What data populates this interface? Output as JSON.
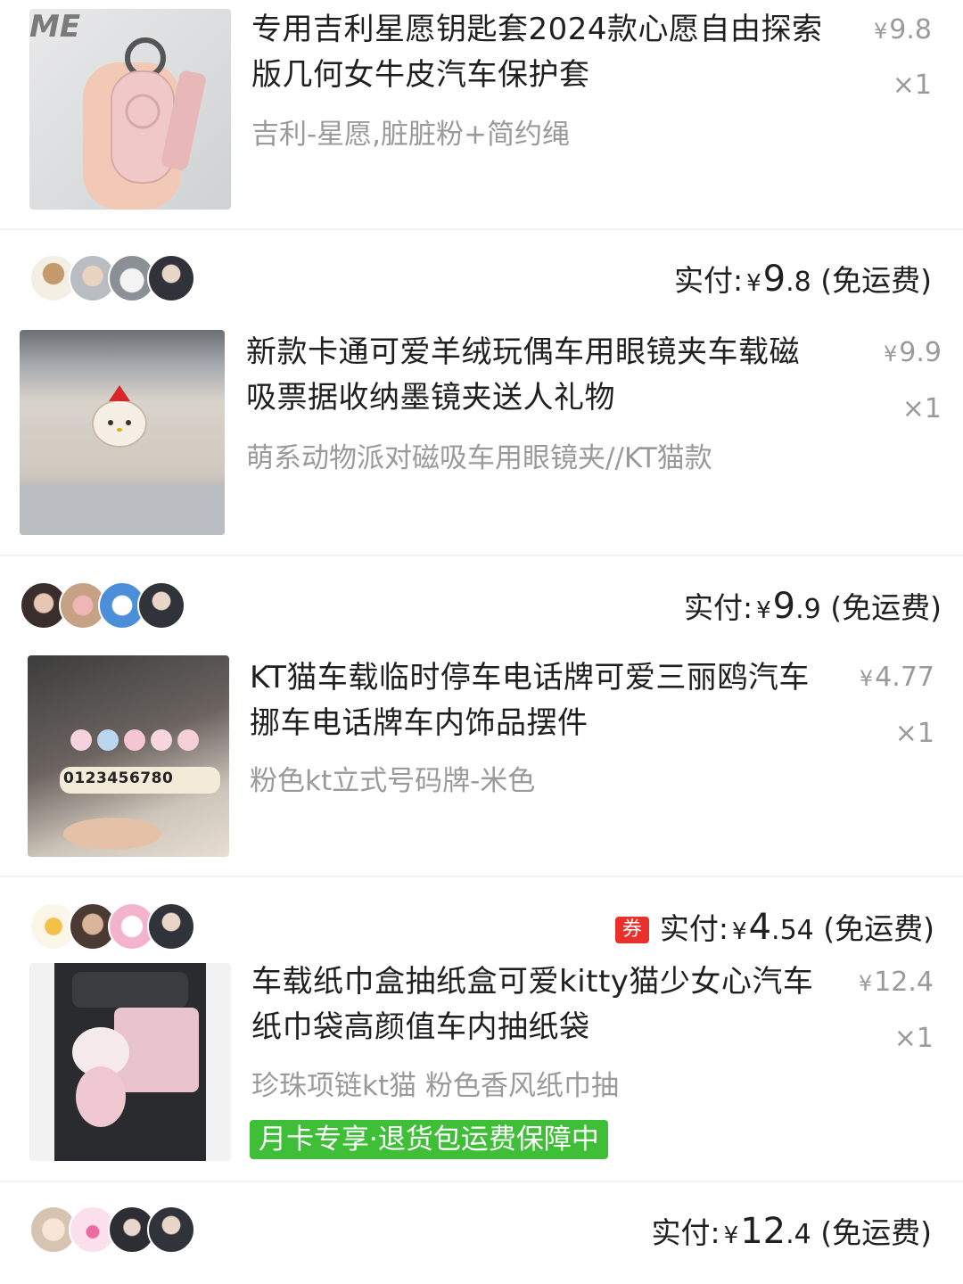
{
  "colors": {
    "text_primary": "#1f1f1f",
    "text_secondary": "#9a9a9a",
    "coupon_red": "#e9302b",
    "promo_green": "#3fbe38",
    "divider": "#f2f2f2"
  },
  "orders": [
    {
      "title": "专用吉利星愿钥匙套2024款心愿自由探索版几何女牛皮汽车保护套",
      "sku": "吉利-星愿,脏脏粉+简约绳",
      "price_symbol": "¥",
      "unit_price": "9.8",
      "quantity": "×1",
      "photo_text": "ME",
      "paid_label": "实付:",
      "paid_int": "9",
      "paid_dec": ".8",
      "shipping_note": "(免运费)"
    },
    {
      "title": "新款卡通可爱羊绒玩偶车用眼镜夹车载磁吸票据收纳墨镜夹送人礼物",
      "sku": "萌系动物派对磁吸车用眼镜夹//KT猫款",
      "price_symbol": "¥",
      "unit_price": "9.9",
      "quantity": "×1",
      "paid_label": "实付:",
      "paid_int": "9",
      "paid_dec": ".9",
      "shipping_note": "(免运费)"
    },
    {
      "title": "KT猫车载临时停车电话牌可爱三丽鸥汽车挪车电话牌车内饰品摆件",
      "sku": "粉色kt立式号码牌-米色",
      "price_symbol": "¥",
      "unit_price": "4.77",
      "quantity": "×1",
      "photo_text": "0123456780",
      "coupon_label": "券",
      "paid_label": "实付:",
      "paid_int": "4",
      "paid_dec": ".54",
      "shipping_note": "(免运费)"
    },
    {
      "title": "车载纸巾盒抽纸盒可爱kitty猫少女心汽车纸巾袋高颜值车内抽纸袋",
      "sku": "珍珠项链kt猫 粉色香风纸巾抽",
      "price_symbol": "¥",
      "unit_price": "12.4",
      "quantity": "×1",
      "promo": "月卡专享·退货包运费保障中",
      "paid_label": "实付:",
      "paid_int": "12",
      "paid_dec": ".4",
      "shipping_note": "(免运费)"
    }
  ]
}
